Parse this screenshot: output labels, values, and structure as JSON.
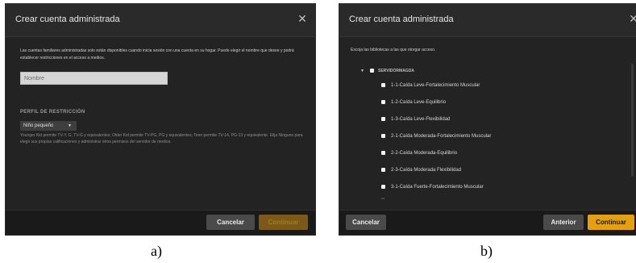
{
  "panel_a": {
    "title": "Crear cuenta administrada",
    "intro": "Las cuentas familiares administradas solo están disponibles cuando inicia sesión con una cuenta en su hogar. Puede elegir el nombre que desee y podrá establecer restricciones en el acceso a medios.",
    "name_placeholder": "Nombre",
    "section_label": "PERFIL DE RESTRICCIÓN",
    "profile_selected": "Niño pequeño",
    "profile_description": "Younger Kid permite TV-Y, G, TV-G y equivalentes; Older Kid permite TV-PG, PG y equivalentes; Teen permite TV-14, PG-13 y equivalente. Elija Ninguno para elegir sus propias calificaciones y administrar otros permisos del servidor de medios.",
    "cancel": "Cancelar",
    "continue": "Continuar",
    "caption": "a)"
  },
  "panel_b": {
    "title": "Crear cuenta administrada",
    "intro": "Escoja las bibliotecas a las que otorgar acceso.",
    "server": "SERVIDORMAGDA",
    "libraries": [
      "1-1-Caída Leve-Fortalecimiento Muscular",
      "1-2-Caída Leve-Equilibrio",
      "1-3-Caída Leve-Flexibilidad",
      "2-1-Caída Moderada-Fortalecimiento Muscular",
      "2-2-Caída Moderada-Equilibrio",
      "2-3-Caída Moderada Flexibilidad",
      "3-1-Caída Fuerte-Fortalecimiento Muscular"
    ],
    "cancel": "Cancelar",
    "previous": "Anterior",
    "continue": "Continuar",
    "caption": "b)"
  },
  "icons": {
    "close": "close-icon",
    "expand": "chevron-down-icon",
    "dropdown": "caret-down-icon"
  },
  "colors": {
    "dialog_bg": "#232323",
    "accent": "#e5a00d",
    "footer_bg": "#1a1a1a"
  }
}
